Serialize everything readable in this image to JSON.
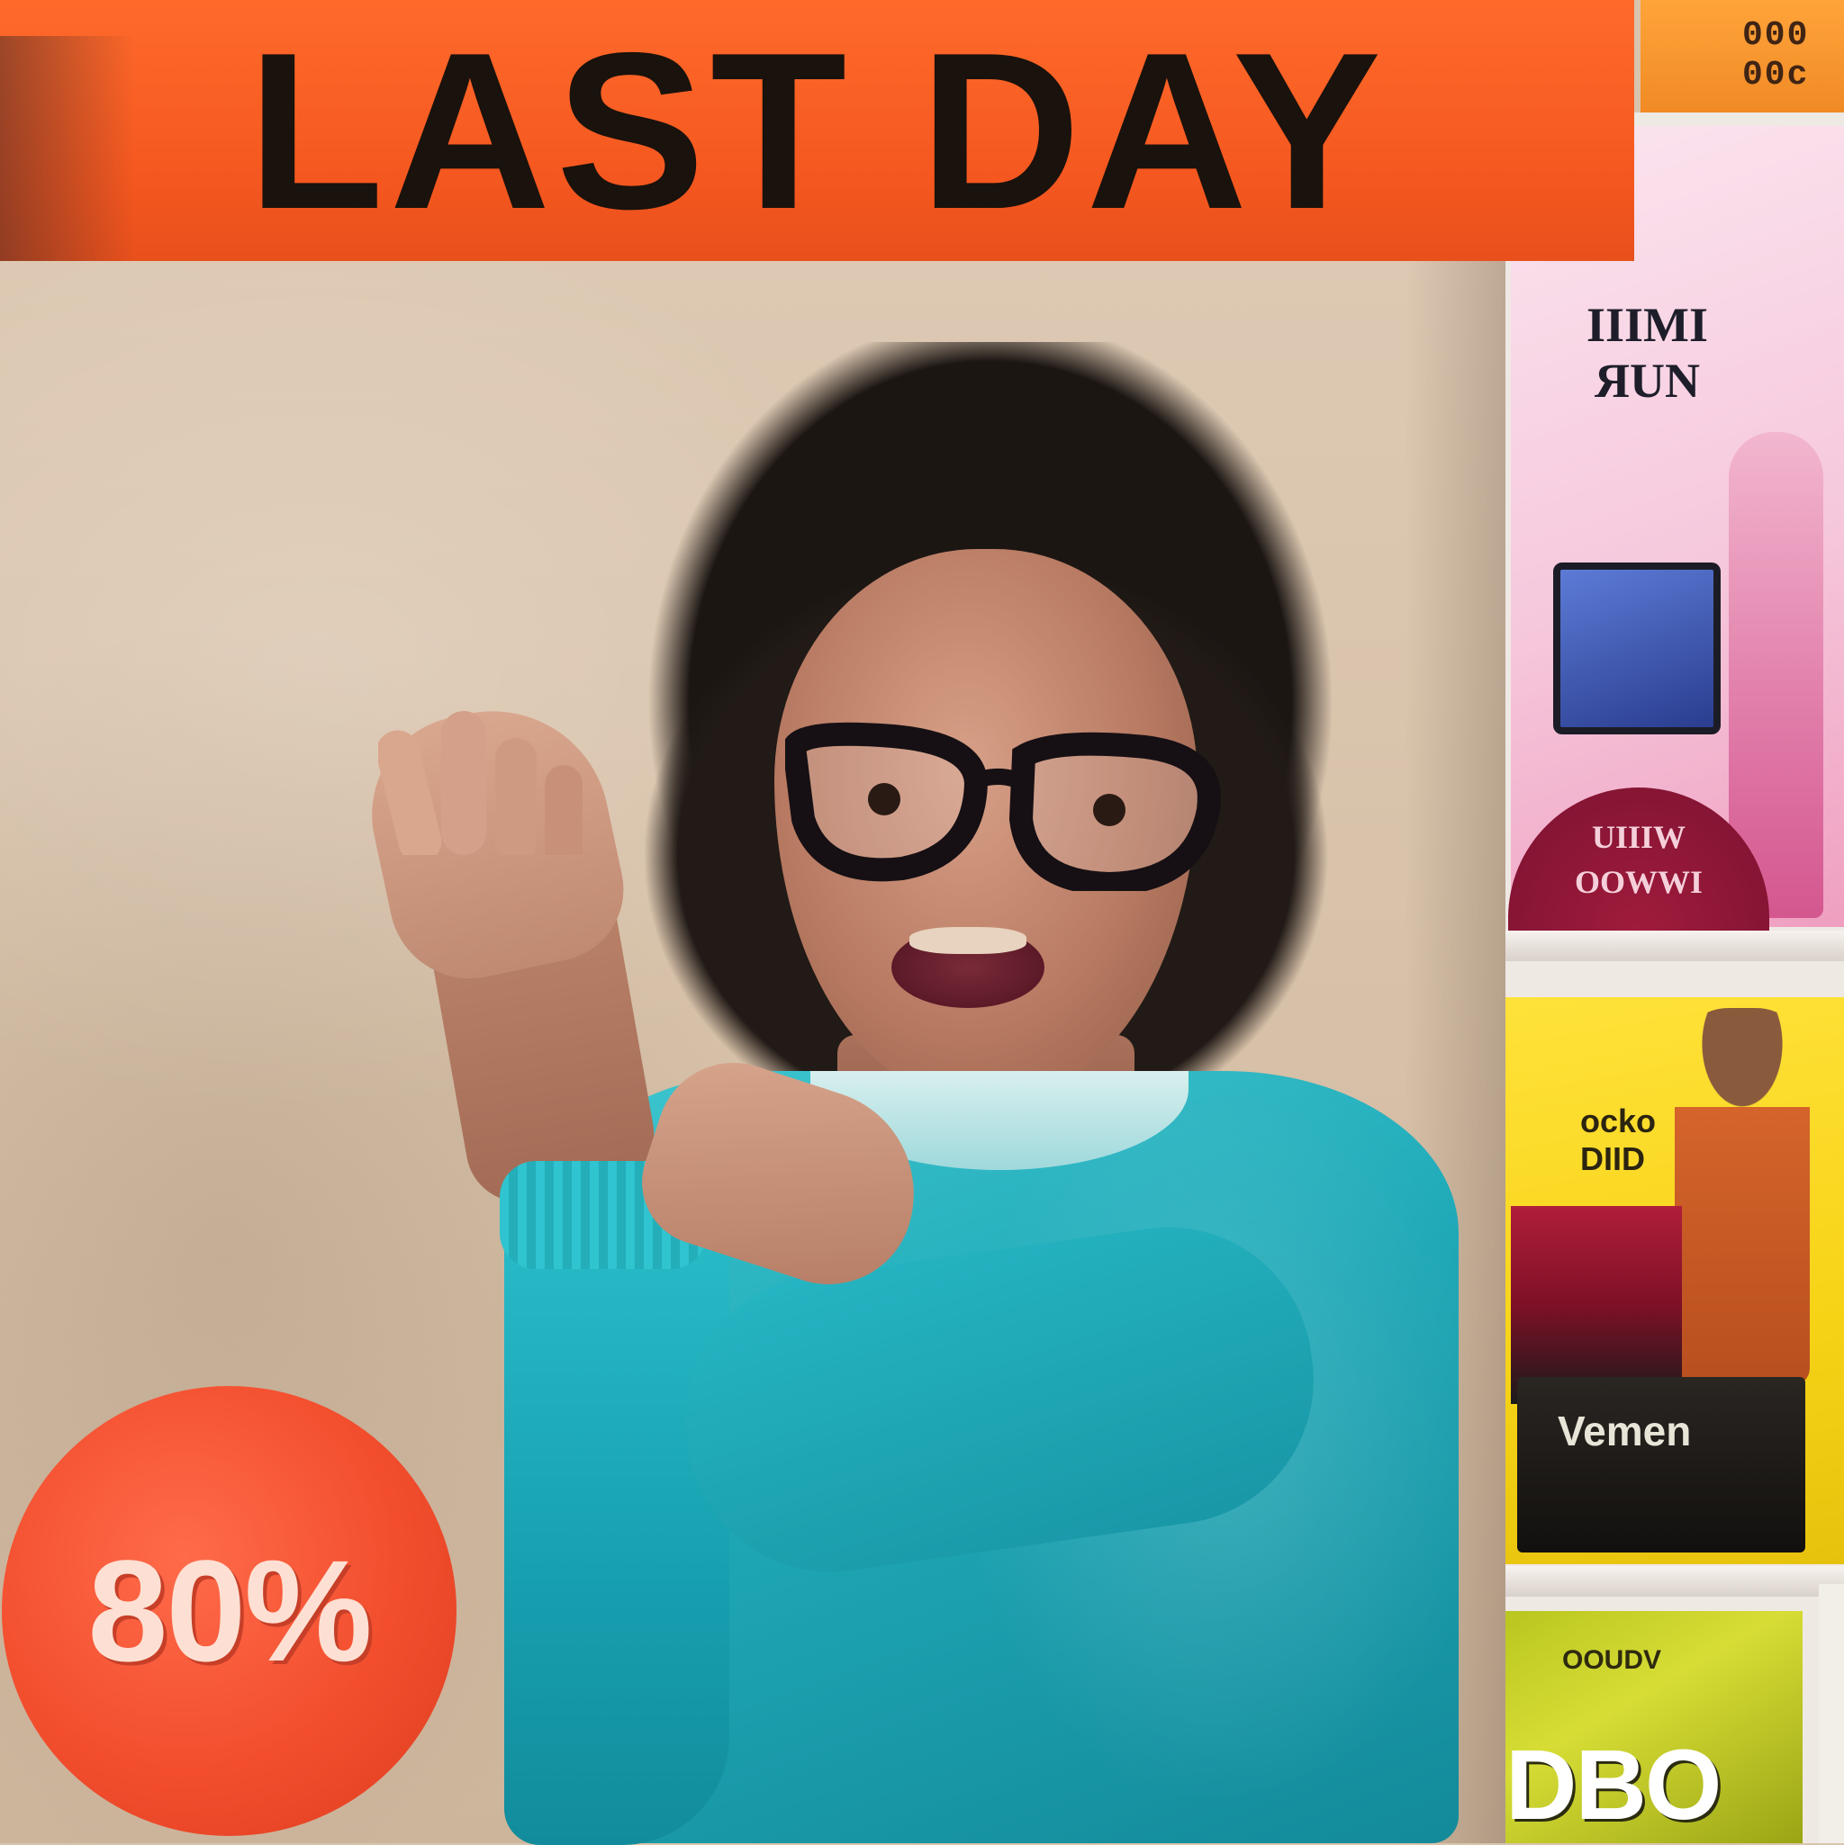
{
  "banner": {
    "headline": "LAST DAY",
    "stub_text": "000\n00c"
  },
  "discount": {
    "badge": "80%"
  },
  "shelf": {
    "pink_poster_sign": "IIIMI\nЯUN",
    "pink_dome_text": "UIIIW\nOOWWI",
    "yellow_poster_sign": "ocko\nDIID",
    "yellow_bag_text": "Vemen",
    "green_poster_sign": "OOUDV",
    "green_poster_big": "DBO"
  },
  "colors": {
    "banner_orange": "#f4571f",
    "headline_black": "#1a120c",
    "sticker_red": "#f24e2e",
    "sweater_teal": "#1fa8b7",
    "wall_beige": "#d9c4ad"
  }
}
